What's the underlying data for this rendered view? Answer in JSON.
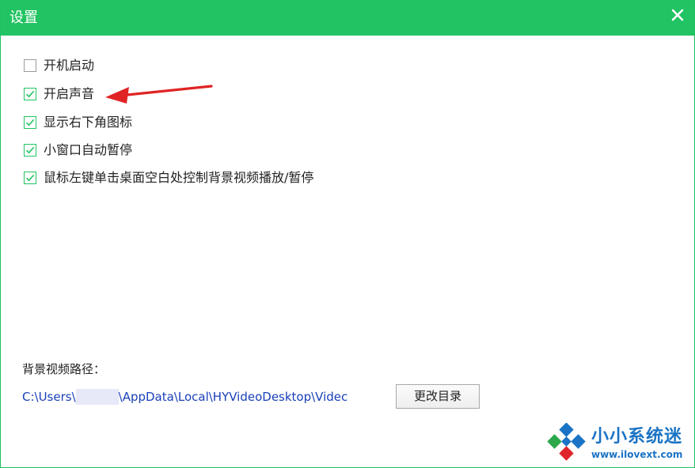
{
  "window": {
    "title": "设置",
    "accent_color": "#22c362",
    "close_icon": "close-icon"
  },
  "options": [
    {
      "label": "开机启动",
      "checked": false
    },
    {
      "label": "开启声音",
      "checked": true
    },
    {
      "label": "显示右下角图标",
      "checked": true
    },
    {
      "label": "小窗口自动暂停",
      "checked": true
    },
    {
      "label": "鼠标左键单击桌面空白处控制背景视频播放/暂停",
      "checked": true
    }
  ],
  "path_section": {
    "title": "背景视频路径：",
    "path_prefix": "C:\\Users\\",
    "path_suffix": "\\AppData\\Local\\HYVideoDesktop\\Videc",
    "path_color": "#1a3fb8",
    "change_button": "更改目录"
  },
  "watermark": {
    "name": "小小系统迷",
    "url": "www.ilovext.com"
  }
}
